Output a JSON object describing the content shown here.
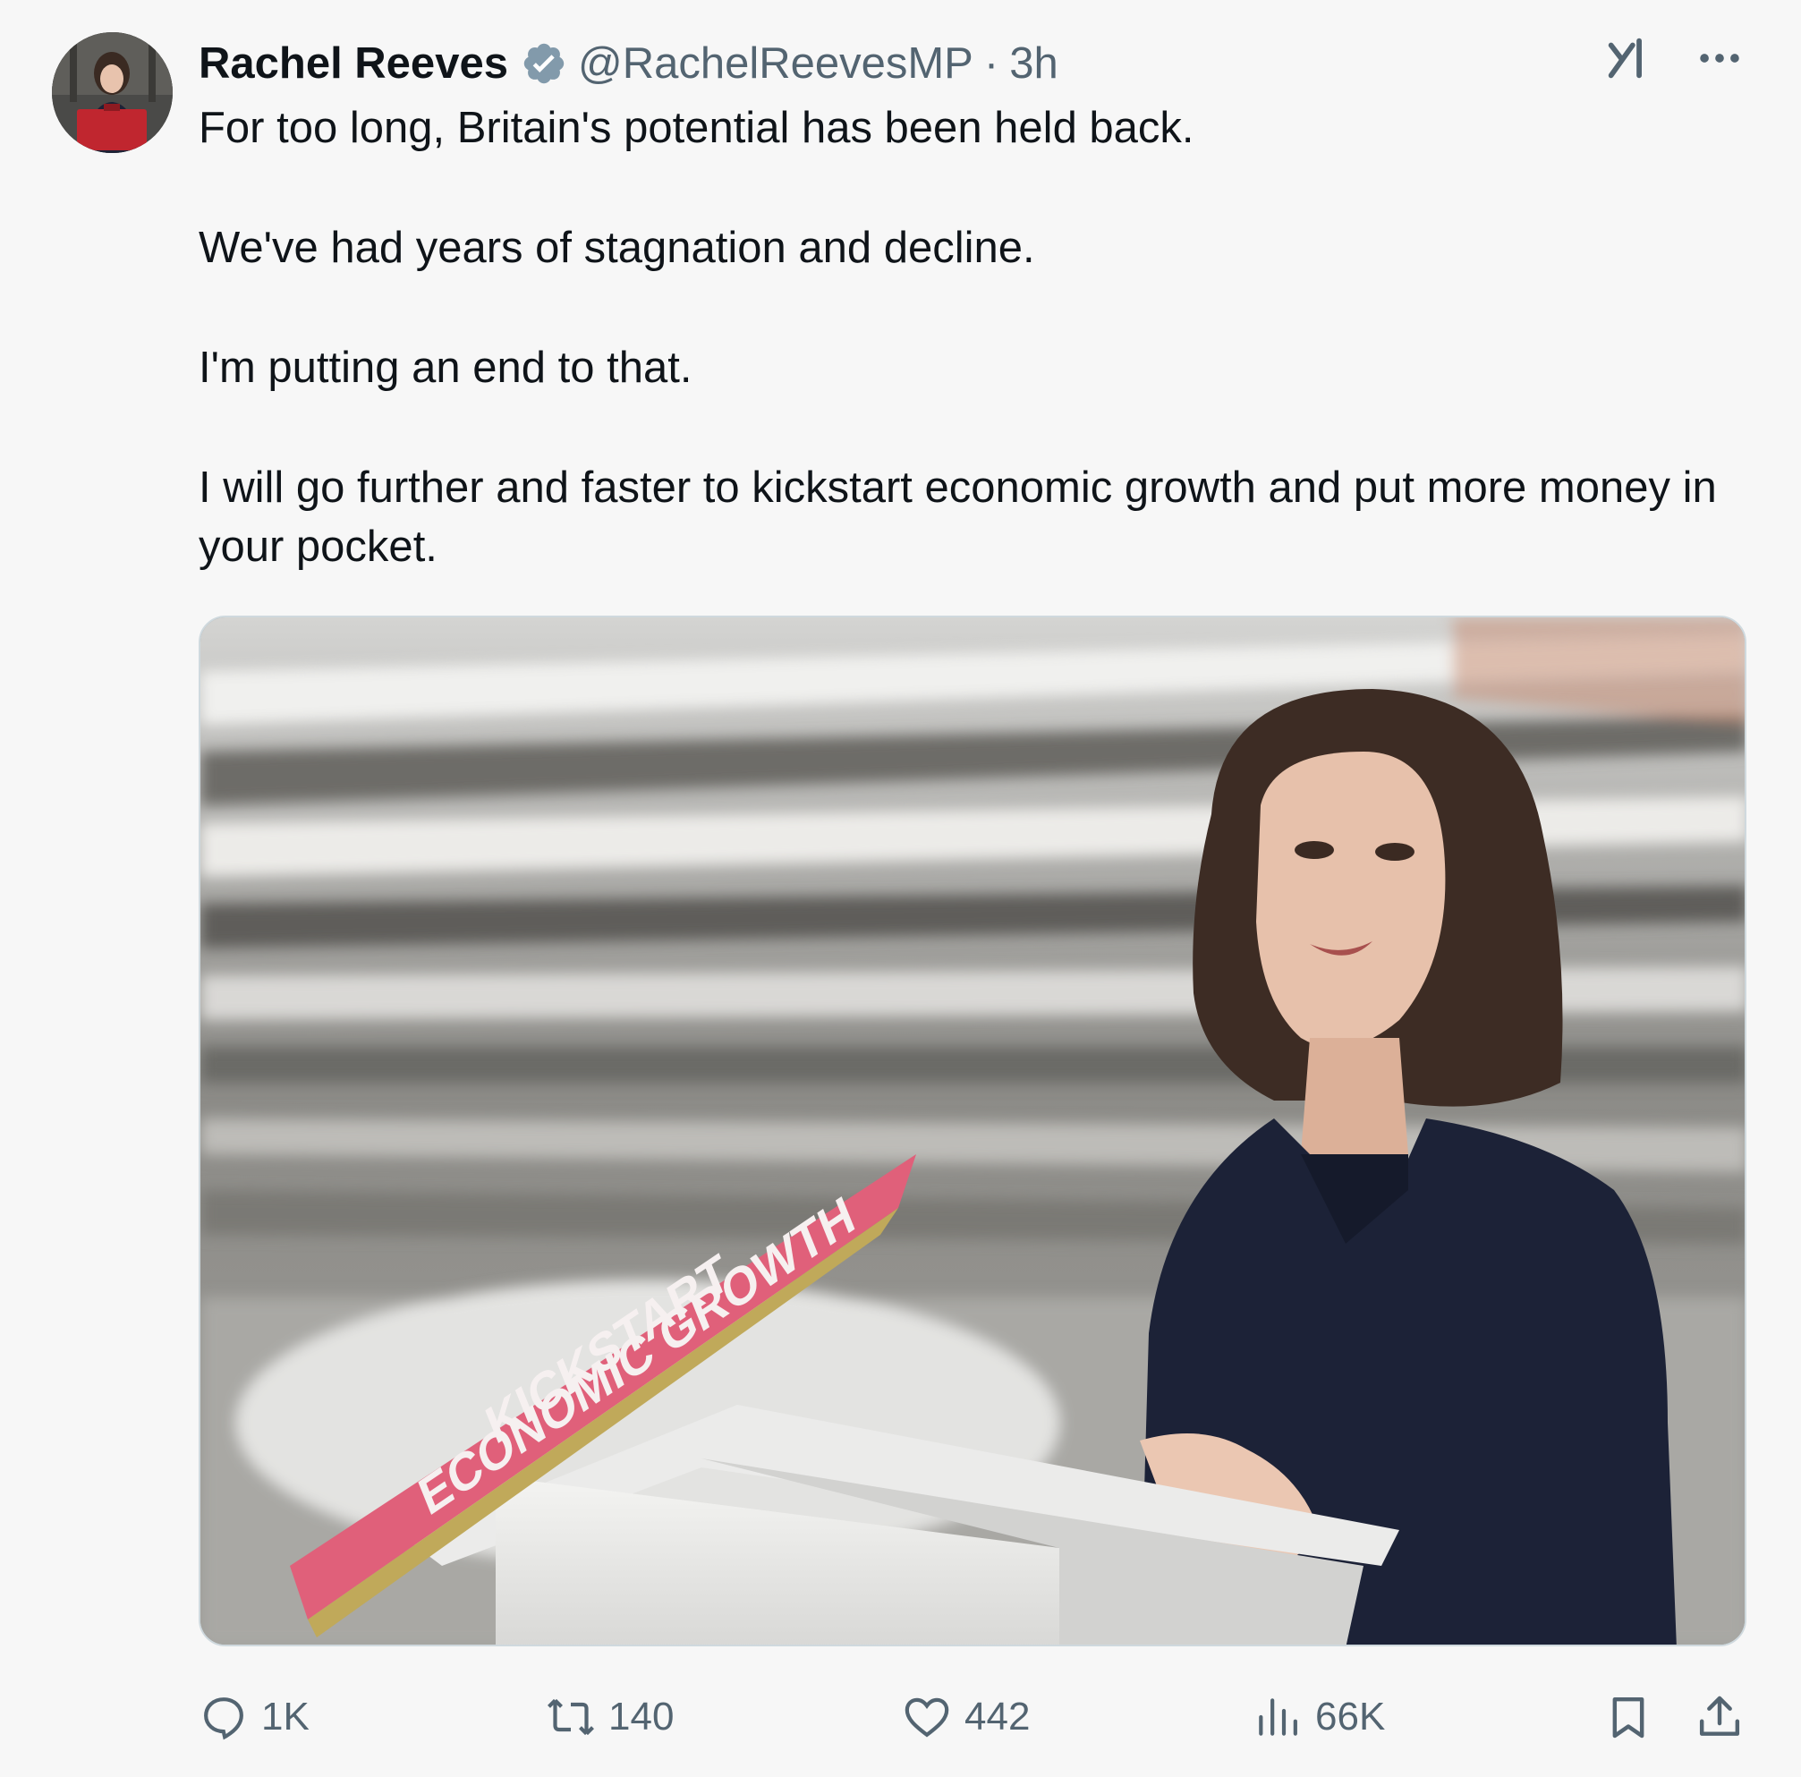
{
  "author": {
    "display_name": "Rachel Reeves",
    "handle": "@RachelReevesMP",
    "separator": "·",
    "time": "3h",
    "verified": true
  },
  "icons": {
    "verified": "verified-badge-icon",
    "grok": "grok-icon",
    "more": "more-options-icon",
    "reply": "reply-icon",
    "retweet": "retweet-icon",
    "like": "heart-icon",
    "views": "views-chart-icon",
    "bookmark": "bookmark-icon",
    "share": "share-icon"
  },
  "tweet": {
    "paragraphs": [
      "For too long, Britain's potential has been held back.",
      "We've had years of stagnation and decline.",
      "I'm putting an end to that.",
      "I will go further and faster to kickstart economic growth and put more money in your pocket."
    ]
  },
  "media": {
    "podium_sign_line1": "KICKSTART",
    "podium_sign_line2": "ECONOMIC GROWTH"
  },
  "metrics": {
    "replies": "1K",
    "retweets": "140",
    "likes": "442",
    "views": "66K"
  },
  "colors": {
    "background": "#f7f7f7",
    "text_primary": "#0f1419",
    "text_secondary": "#536471",
    "verified_badge": "#829aab",
    "sign_pink": "#e0607a"
  }
}
